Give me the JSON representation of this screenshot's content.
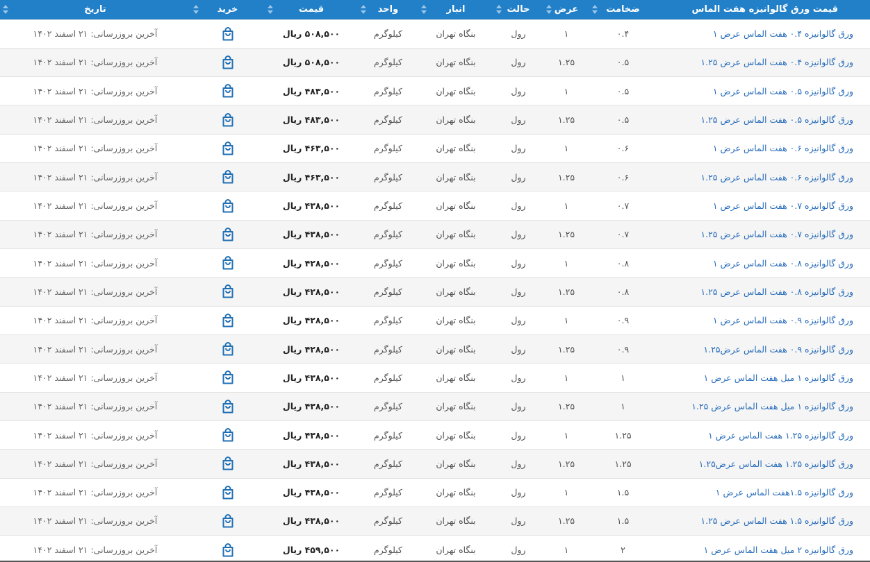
{
  "header": {
    "name": "قیمت ورق گالوانیزه هفت الماس",
    "thickness": "ضخامت",
    "width": "عرض",
    "state": "حالت",
    "warehouse": "انبار",
    "unit": "واحد",
    "price": "قیمت",
    "buy": "خرید",
    "date": "تاریخ"
  },
  "buy_icon": "shopping-bag-icon",
  "colors": {
    "header_bg": "#2280c9",
    "link": "#2a6ebb"
  },
  "rows": [
    {
      "name": "ورق گالوانیزه ۰.۴ هفت الماس عرض ۱",
      "thickness": "۰.۴",
      "width": "۱",
      "state": "رول",
      "warehouse": "بنگاه تهران",
      "unit": "کیلوگرم",
      "price": "۵۰۸,۵۰۰ ریال",
      "date": "آخرین بروزرسانی: ۲۱ اسفند ۱۴۰۲"
    },
    {
      "name": "ورق گالوانیزه ۰.۴ هفت الماس عرض ۱.۲۵",
      "thickness": "۰.۵",
      "width": "۱.۲۵",
      "state": "رول",
      "warehouse": "بنگاه تهران",
      "unit": "کیلوگرم",
      "price": "۵۰۸,۵۰۰ ریال",
      "date": "آخرین بروزرسانی: ۲۱ اسفند ۱۴۰۲"
    },
    {
      "name": "ورق گالوانیزه ۰.۵ هفت الماس عرض ۱",
      "thickness": "۰.۵",
      "width": "۱",
      "state": "رول",
      "warehouse": "بنگاه تهران",
      "unit": "کیلوگرم",
      "price": "۴۸۳,۵۰۰ ریال",
      "date": "آخرین بروزرسانی: ۲۱ اسفند ۱۴۰۲"
    },
    {
      "name": "ورق گالوانیزه ۰.۵ هفت الماس عرض ۱.۲۵",
      "thickness": "۰.۵",
      "width": "۱.۲۵",
      "state": "رول",
      "warehouse": "بنگاه تهران",
      "unit": "کیلوگرم",
      "price": "۴۸۳,۵۰۰ ریال",
      "date": "آخرین بروزرسانی: ۲۱ اسفند ۱۴۰۲"
    },
    {
      "name": "ورق گالوانیزه ۰.۶ هفت الماس عرض ۱",
      "thickness": "۰.۶",
      "width": "۱",
      "state": "رول",
      "warehouse": "بنگاه تهران",
      "unit": "کیلوگرم",
      "price": "۴۶۳,۵۰۰ ریال",
      "date": "آخرین بروزرسانی: ۲۱ اسفند ۱۴۰۲"
    },
    {
      "name": "ورق گالوانیزه ۰.۶ هفت الماس عرض ۱.۲۵",
      "thickness": "۰.۶",
      "width": "۱.۲۵",
      "state": "رول",
      "warehouse": "بنگاه تهران",
      "unit": "کیلوگرم",
      "price": "۴۶۳,۵۰۰ ریال",
      "date": "آخرین بروزرسانی: ۲۱ اسفند ۱۴۰۲"
    },
    {
      "name": "ورق گالوانیزه ۰.۷ هفت الماس عرض ۱",
      "thickness": "۰.۷",
      "width": "۱",
      "state": "رول",
      "warehouse": "بنگاه تهران",
      "unit": "کیلوگرم",
      "price": "۴۳۸,۵۰۰ ریال",
      "date": "آخرین بروزرسانی: ۲۱ اسفند ۱۴۰۲"
    },
    {
      "name": "ورق گالوانیزه ۰.۷ هفت الماس عرض ۱.۲۵",
      "thickness": "۰.۷",
      "width": "۱.۲۵",
      "state": "رول",
      "warehouse": "بنگاه تهران",
      "unit": "کیلوگرم",
      "price": "۴۳۸,۵۰۰ ریال",
      "date": "آخرین بروزرسانی: ۲۱ اسفند ۱۴۰۲"
    },
    {
      "name": "ورق گالوانیزه ۰.۸ هفت الماس عرض ۱",
      "thickness": "۰.۸",
      "width": "۱",
      "state": "رول",
      "warehouse": "بنگاه تهران",
      "unit": "کیلوگرم",
      "price": "۴۲۸,۵۰۰ ریال",
      "date": "آخرین بروزرسانی: ۲۱ اسفند ۱۴۰۲"
    },
    {
      "name": "ورق گالوانیزه ۰.۸ هفت الماس عرض ۱.۲۵",
      "thickness": "۰.۸",
      "width": "۱.۲۵",
      "state": "رول",
      "warehouse": "بنگاه تهران",
      "unit": "کیلوگرم",
      "price": "۴۲۸,۵۰۰ ریال",
      "date": "آخرین بروزرسانی: ۲۱ اسفند ۱۴۰۲"
    },
    {
      "name": "ورق گالوانیزه ۰.۹ هفت الماس عرض ۱",
      "thickness": "۰.۹",
      "width": "۱",
      "state": "رول",
      "warehouse": "بنگاه تهران",
      "unit": "کیلوگرم",
      "price": "۴۲۸,۵۰۰ ریال",
      "date": "آخرین بروزرسانی: ۲۱ اسفند ۱۴۰۲"
    },
    {
      "name": "ورق گالوانیزه ۰.۹ هفت الماس عرض۱.۲۵",
      "thickness": "۰.۹",
      "width": "۱.۲۵",
      "state": "رول",
      "warehouse": "بنگاه تهران",
      "unit": "کیلوگرم",
      "price": "۴۲۸,۵۰۰ ریال",
      "date": "آخرین بروزرسانی: ۲۱ اسفند ۱۴۰۲"
    },
    {
      "name": "ورق گالوانیزه ۱ میل هفت الماس عرض ۱",
      "thickness": "۱",
      "width": "۱",
      "state": "رول",
      "warehouse": "بنگاه تهران",
      "unit": "کیلوگرم",
      "price": "۴۳۸,۵۰۰ ریال",
      "date": "آخرین بروزرسانی: ۲۱ اسفند ۱۴۰۲"
    },
    {
      "name": "ورق گالوانیزه ۱ میل هفت الماس عرض ۱.۲۵",
      "thickness": "۱",
      "width": "۱.۲۵",
      "state": "رول",
      "warehouse": "بنگاه تهران",
      "unit": "کیلوگرم",
      "price": "۴۳۸,۵۰۰ ریال",
      "date": "آخرین بروزرسانی: ۲۱ اسفند ۱۴۰۲"
    },
    {
      "name": "ورق گالوانیزه ۱.۲۵ هفت الماس عرض ۱",
      "thickness": "۱.۲۵",
      "width": "۱",
      "state": "رول",
      "warehouse": "بنگاه تهران",
      "unit": "کیلوگرم",
      "price": "۴۳۸,۵۰۰ ریال",
      "date": "آخرین بروزرسانی: ۲۱ اسفند ۱۴۰۲"
    },
    {
      "name": "ورق گالوانیزه ۱.۲۵ هفت الماس عرض۱.۲۵",
      "thickness": "۱.۲۵",
      "width": "۱.۲۵",
      "state": "رول",
      "warehouse": "بنگاه تهران",
      "unit": "کیلوگرم",
      "price": "۴۳۸,۵۰۰ ریال",
      "date": "آخرین بروزرسانی: ۲۱ اسفند ۱۴۰۲"
    },
    {
      "name": "ورق گالوانیزه ۱.۵هفت الماس عرض ۱",
      "thickness": "۱.۵",
      "width": "۱",
      "state": "رول",
      "warehouse": "بنگاه تهران",
      "unit": "کیلوگرم",
      "price": "۴۳۸,۵۰۰ ریال",
      "date": "آخرین بروزرسانی: ۲۱ اسفند ۱۴۰۲"
    },
    {
      "name": "ورق گالوانیزه ۱.۵ هفت الماس عرض ۱.۲۵",
      "thickness": "۱.۵",
      "width": "۱.۲۵",
      "state": "رول",
      "warehouse": "بنگاه تهران",
      "unit": "کیلوگرم",
      "price": "۴۳۸,۵۰۰ ریال",
      "date": "آخرین بروزرسانی: ۲۱ اسفند ۱۴۰۲"
    },
    {
      "name": "ورق گالوانیزه ۲ میل هفت الماس عرض ۱",
      "thickness": "۲",
      "width": "۱",
      "state": "رول",
      "warehouse": "بنگاه تهران",
      "unit": "کیلوگرم",
      "price": "۴۵۹,۵۰۰ ریال",
      "date": "آخرین بروزرسانی: ۲۱ اسفند ۱۴۰۲"
    }
  ]
}
